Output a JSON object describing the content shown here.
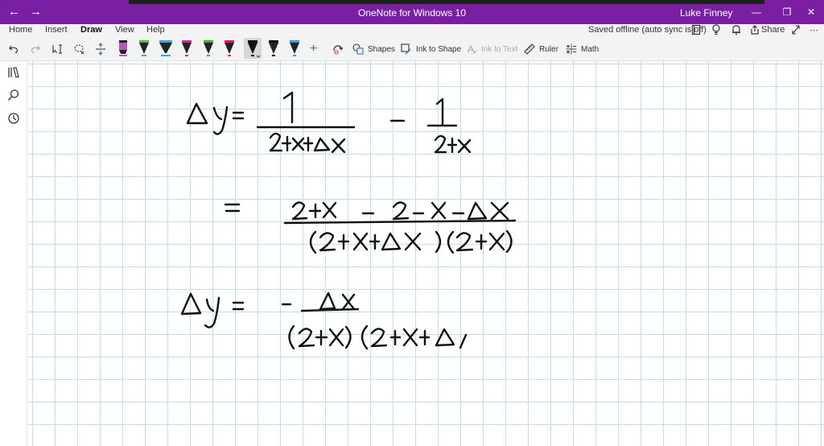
{
  "titlebar": {
    "back": "←",
    "forward": "→",
    "title": "OneNote for Windows 10",
    "user": "Luke Finney",
    "minimize": "—",
    "restore": "❐",
    "close": "✕"
  },
  "menu": {
    "tabs": [
      {
        "label": "Home"
      },
      {
        "label": "Insert"
      },
      {
        "label": "Draw"
      },
      {
        "label": "View"
      },
      {
        "label": "Help"
      }
    ],
    "sync_status": "Saved offline (auto sync is off)",
    "share_label": "Share",
    "more": "⋯"
  },
  "toolbar": {
    "shapes_label": "Shapes",
    "ink_to_shape_label": "Ink to Shape",
    "ink_to_text_label": "Ink to Text",
    "ruler_label": "Ruler",
    "math_label": "Math",
    "add_pen": "+",
    "pens": [
      {
        "color": "#b455c9",
        "kind": "highlighter"
      },
      {
        "color": "#4cc02a",
        "kind": "pen"
      },
      {
        "color": "#3aa7e0",
        "kind": "highlighter"
      },
      {
        "color": "#d8279a",
        "kind": "pen"
      },
      {
        "color": "#38b23b",
        "kind": "pen"
      },
      {
        "color": "#e0205a",
        "kind": "pen"
      },
      {
        "color": "#111111",
        "kind": "pen-selected"
      },
      {
        "color": "#111111",
        "kind": "pen"
      },
      {
        "color": "#2d9ce6",
        "kind": "pen"
      }
    ]
  },
  "colors": {
    "accent": "#7a1fa2",
    "grid": "#c3dbec",
    "ink": "#111111"
  }
}
